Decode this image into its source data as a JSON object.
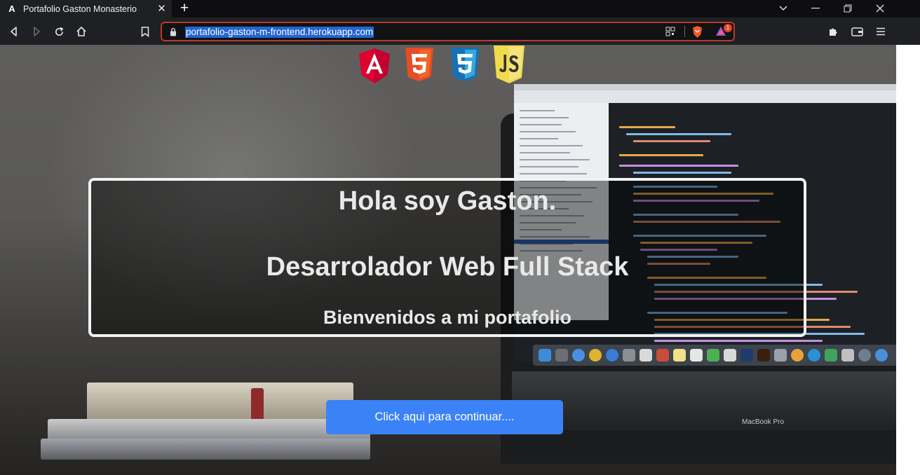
{
  "browser": {
    "tab": {
      "favicon_letter": "A",
      "title": "Portafolio Gaston Monasterio"
    },
    "url": "portafolio-gaston-m-frontend.herokuapp.com",
    "shields_badge": "1",
    "accent_colors": {
      "url_highlight": "#2366d1",
      "urlbar_border": "#b73a2a",
      "brave_orange": "#fb542b"
    }
  },
  "page": {
    "logos": [
      {
        "name": "Angular",
        "letter": "A",
        "color": "#dd0031"
      },
      {
        "name": "HTML5",
        "letter": "5",
        "color": "#e44d26"
      },
      {
        "name": "CSS3",
        "letter": "3",
        "color": "#1572b6"
      },
      {
        "name": "JavaScript",
        "letter": "JS",
        "color": "#f0db4f"
      }
    ],
    "hero": {
      "title": "Hola soy Gaston.",
      "subtitle": "Desarrolador Web Full Stack",
      "welcome": "Bienvenidos a mi portafolio"
    },
    "cta_label": "Click aqui para continuar....",
    "cta_color": "#3b82f6",
    "laptop_brand": "MacBook Pro"
  }
}
